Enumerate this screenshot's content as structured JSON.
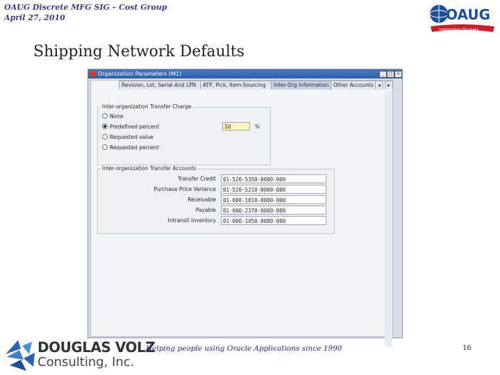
{
  "header": {
    "line1": "OAUG Discrete MFG SIG – Cost Group",
    "line2": "April 27, 2010"
  },
  "logo": {
    "text": "OAUG",
    "tagline": "celebrating 20 years",
    "colors": {
      "blue": "#1f4f9a",
      "red": "#c8202a"
    }
  },
  "slide_title": "Shipping Network Defaults",
  "window": {
    "title": "Organization Parameters (M1)",
    "tabs": [
      {
        "label": "Revision, Lot, Serial And LPN"
      },
      {
        "label": "ATP, Pick, Item-Sourcing"
      },
      {
        "label": "Inter-Org Information"
      },
      {
        "label": "Other Accounts"
      }
    ],
    "transfer_group": {
      "label": "Inter-organization Transfer Charge",
      "options": [
        "None",
        "Predefined percent",
        "Requested value",
        "Requested percent"
      ],
      "selected_index": 1,
      "percent_value": "10",
      "percent_symbol": "%"
    },
    "accounts_group": {
      "label": "Inter-organization Transfer Accounts",
      "rows": [
        {
          "label": "Transfer Credit",
          "value": "01-520-5350-0000-000"
        },
        {
          "label": "Purchase Price Variance",
          "value": "01-520-5210-0000-000"
        },
        {
          "label": "Receivable",
          "value": "01-000-1810-0000-000"
        },
        {
          "label": "Payable",
          "value": "01-000-2370-0000-000"
        },
        {
          "label": "Intransit Inventory",
          "value": "01-000-1450-0000-000"
        }
      ]
    }
  },
  "footer": {
    "tagline": "Helping people using Oracle Applications since 1990",
    "page_number": "16",
    "company_line1": "DOUGLAS VOLZ",
    "company_line2": "Consulting, Inc."
  }
}
